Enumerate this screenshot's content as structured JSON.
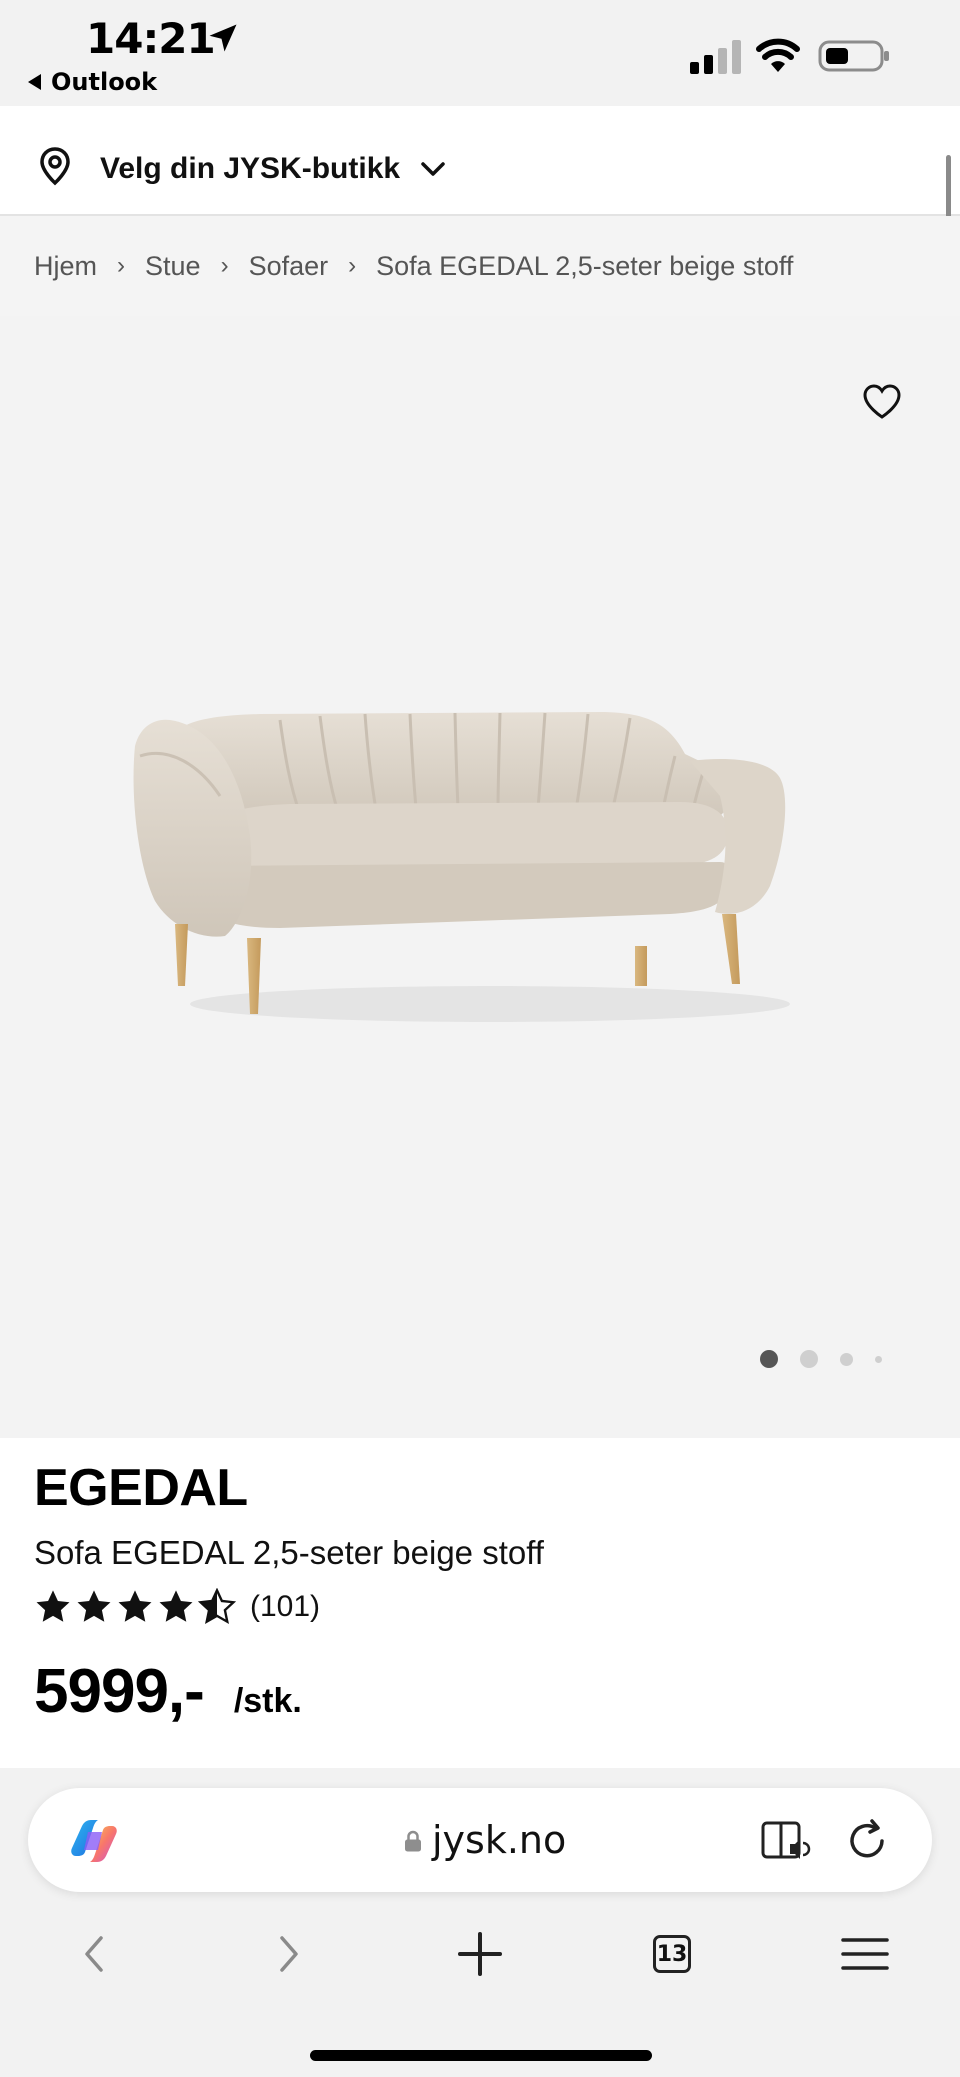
{
  "status_bar": {
    "time": "14:21",
    "back_app": "Outlook"
  },
  "store_bar": {
    "label": "Velg din JYSK-butikk"
  },
  "breadcrumb": {
    "items": [
      "Hjem",
      "Stue",
      "Sofaer",
      "Sofa EGEDAL 2,5-seter beige stoff"
    ]
  },
  "gallery": {
    "image_count": 4,
    "active_index": 0
  },
  "product": {
    "brand": "EGEDAL",
    "title": "Sofa EGEDAL 2,5-seter beige stoff",
    "rating": 4.5,
    "rating_max": 5,
    "review_count": "(101)",
    "price": "5999,-",
    "unit": "/stk."
  },
  "browser": {
    "url": "jysk.no",
    "tab_count": "13"
  },
  "icons": {
    "location": "location-arrow-icon",
    "pin": "map-pin-icon",
    "heart": "heart-icon",
    "star": "star-icon"
  }
}
